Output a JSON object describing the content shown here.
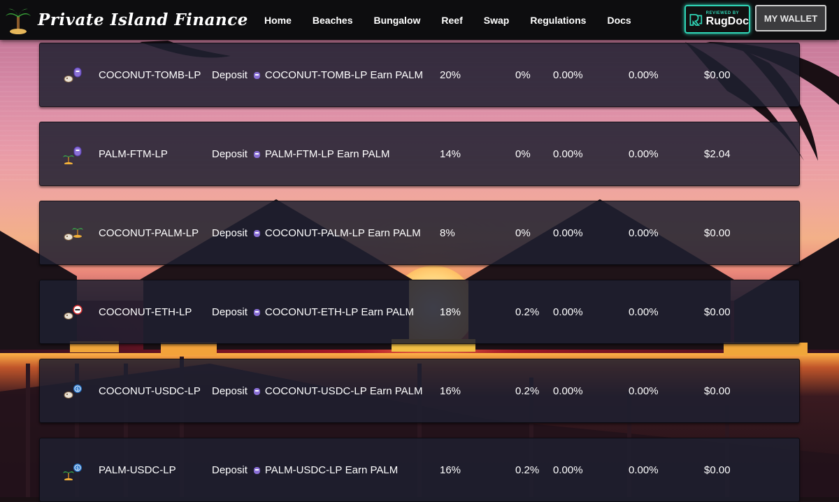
{
  "header": {
    "brand_title": "Private Island Finance",
    "logo_icon": "palm-tree-icon",
    "nav": [
      "Home",
      "Beaches",
      "Bungalow",
      "Reef",
      "Swap",
      "Regulations",
      "Docs"
    ],
    "rugdoc_small": "REVIEWED BY",
    "rugdoc_big": "RugDoc",
    "wallet_button": "MY WALLET"
  },
  "farms": [
    {
      "name": "COCONUT-TOMB-LP",
      "deposit_word": "Deposit",
      "lp_label": "COCONUT-TOMB-LP",
      "earn": "Earn PALM",
      "alloc": "20%",
      "deposit_fee": "0%",
      "apr": "0.00%",
      "daily": "0.00%",
      "tvl": "$0.00",
      "icons": [
        "coconut-icon",
        "tomb-icon"
      ]
    },
    {
      "name": "PALM-FTM-LP",
      "deposit_word": "Deposit",
      "lp_label": "PALM-FTM-LP",
      "earn": "Earn PALM",
      "alloc": "14%",
      "deposit_fee": "0%",
      "apr": "0.00%",
      "daily": "0.00%",
      "tvl": "$2.04",
      "icons": [
        "palm-icon",
        "tomb-icon"
      ]
    },
    {
      "name": "COCONUT-PALM-LP",
      "deposit_word": "Deposit",
      "lp_label": "COCONUT-PALM-LP",
      "earn": "Earn PALM",
      "alloc": "8%",
      "deposit_fee": "0%",
      "apr": "0.00%",
      "daily": "0.00%",
      "tvl": "$0.00",
      "icons": [
        "coconut-icon",
        "palm-icon"
      ]
    },
    {
      "name": "COCONUT-ETH-LP",
      "deposit_word": "Deposit",
      "lp_label": "COCONUT-ETH-LP",
      "earn": "Earn PALM",
      "alloc": "18%",
      "deposit_fee": "0.2%",
      "apr": "0.00%",
      "daily": "0.00%",
      "tvl": "$0.00",
      "icons": [
        "coconut-icon",
        "eth-icon"
      ]
    },
    {
      "name": "COCONUT-USDC-LP",
      "deposit_word": "Deposit",
      "lp_label": "COCONUT-USDC-LP",
      "earn": "Earn PALM",
      "alloc": "16%",
      "deposit_fee": "0.2%",
      "apr": "0.00%",
      "daily": "0.00%",
      "tvl": "$0.00",
      "icons": [
        "coconut-icon",
        "usdc-icon"
      ]
    },
    {
      "name": "PALM-USDC-LP",
      "deposit_word": "Deposit",
      "lp_label": "PALM-USDC-LP",
      "earn": "Earn PALM",
      "alloc": "16%",
      "deposit_fee": "0.2%",
      "apr": "0.00%",
      "daily": "0.00%",
      "tvl": "$0.00",
      "icons": [
        "palm-icon",
        "usdc-icon"
      ]
    }
  ],
  "colors": {
    "header_bg": "#0d0d0f",
    "row_bg": "#1e2030",
    "rugdoc_accent": "#2fd4b5",
    "wallet_bg": "#3c3c3e"
  }
}
